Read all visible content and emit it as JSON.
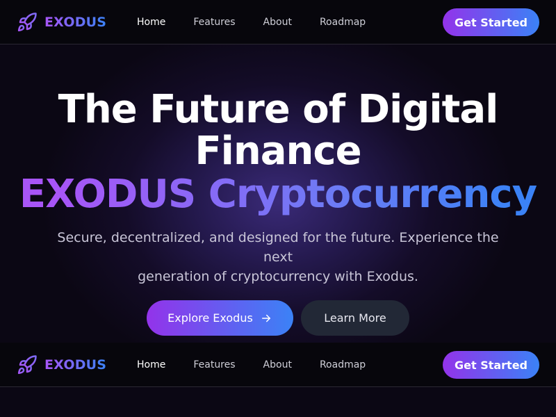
{
  "colors": {
    "accent_start": "#9333ea",
    "accent_end": "#3b82f6",
    "background": "#0a0712"
  },
  "brand": {
    "name": "EXODUS",
    "icon": "rocket-icon"
  },
  "nav": {
    "links": [
      {
        "label": "Home",
        "active": true
      },
      {
        "label": "Features",
        "active": false
      },
      {
        "label": "About",
        "active": false
      },
      {
        "label": "Roadmap",
        "active": false
      }
    ],
    "cta_label": "Get Started"
  },
  "hero": {
    "title_line1": "The Future of Digital",
    "title_line2": "Finance",
    "accent": "EXODUS Cryptocurrency",
    "subtitle_line1": "Secure, decentralized, and designed for the future. Experience the next",
    "subtitle_line2": "generation of cryptocurrency with Exodus.",
    "primary_button": "Explore Exodus",
    "primary_icon": "arrow-right-icon",
    "secondary_button": "Learn More"
  }
}
